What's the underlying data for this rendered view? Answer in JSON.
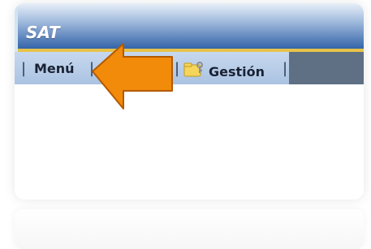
{
  "app": {
    "logo_text": "SAT"
  },
  "menu": {
    "items": [
      {
        "label": "Menú",
        "icon": ""
      },
      {
        "label": "",
        "icon": "green-square-icon"
      },
      {
        "label": "Gestión",
        "icon": "folder-key-icon"
      }
    ],
    "separator": "|"
  },
  "colors": {
    "banner_top": "#e8eff8",
    "banner_bottom": "#2d5fa6",
    "accent_line": "#e6c34a",
    "menubar": "#aac3e2",
    "arrow_fill": "#f28a0a",
    "arrow_stroke": "#b35a00",
    "dark_segment": "#5f6f84"
  }
}
